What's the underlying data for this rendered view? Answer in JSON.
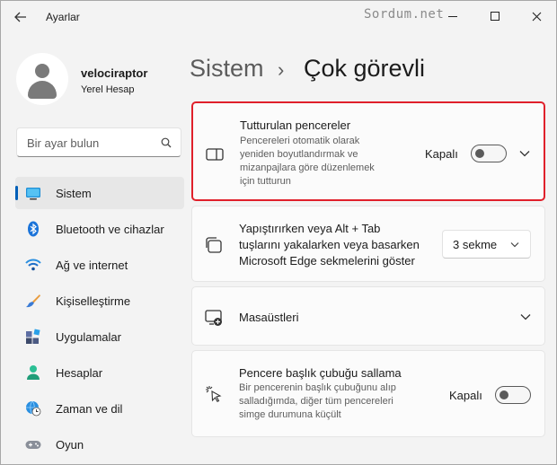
{
  "window": {
    "title": "Ayarlar",
    "watermark": "Sordum.net"
  },
  "profile": {
    "name": "velociraptor",
    "account_type": "Yerel Hesap"
  },
  "search": {
    "placeholder": "Bir ayar bulun"
  },
  "nav": {
    "items": [
      {
        "label": "Sistem",
        "icon": "system-icon",
        "active": true
      },
      {
        "label": "Bluetooth ve cihazlar",
        "icon": "bluetooth-icon"
      },
      {
        "label": "Ağ ve internet",
        "icon": "wifi-icon"
      },
      {
        "label": "Kişiselleştirme",
        "icon": "brush-icon"
      },
      {
        "label": "Uygulamalar",
        "icon": "apps-icon"
      },
      {
        "label": "Hesaplar",
        "icon": "person-icon"
      },
      {
        "label": "Zaman ve dil",
        "icon": "globe-clock-icon"
      },
      {
        "label": "Oyun",
        "icon": "gamepad-icon"
      }
    ]
  },
  "breadcrumb": {
    "parent": "Sistem",
    "separator": "›",
    "current": "Çok görevli"
  },
  "cards": {
    "snap_windows": {
      "title": "Tutturulan pencereler",
      "description_lines": [
        "Pencereleri otomatik olarak",
        "yeniden boyutlandırmak ve",
        "mizanpajlara göre düzenlemek",
        "için tutturun"
      ],
      "toggle_label": "Kapalı",
      "toggle_on": false,
      "highlighted_color": "#e0202b"
    },
    "alt_tab": {
      "title_lines": [
        "Yapıştırırken veya Alt + Tab",
        "tuşlarını yakalarken veya basarken",
        "Microsoft Edge sekmelerini göster"
      ],
      "dropdown_value": "3 sekme"
    },
    "desktops": {
      "title": "Masaüstleri"
    },
    "title_bar_shake": {
      "title": "Pencere başlık çubuğu sallama",
      "description_lines": [
        "Bir pencerenin başlık çubuğunu alıp",
        "salladığımda, diğer tüm pencereleri",
        "simge durumuna küçült"
      ],
      "toggle_label": "Kapalı",
      "toggle_on": false
    }
  },
  "colors": {
    "accent": "#005fb8",
    "highlight_border": "#e0202b"
  }
}
